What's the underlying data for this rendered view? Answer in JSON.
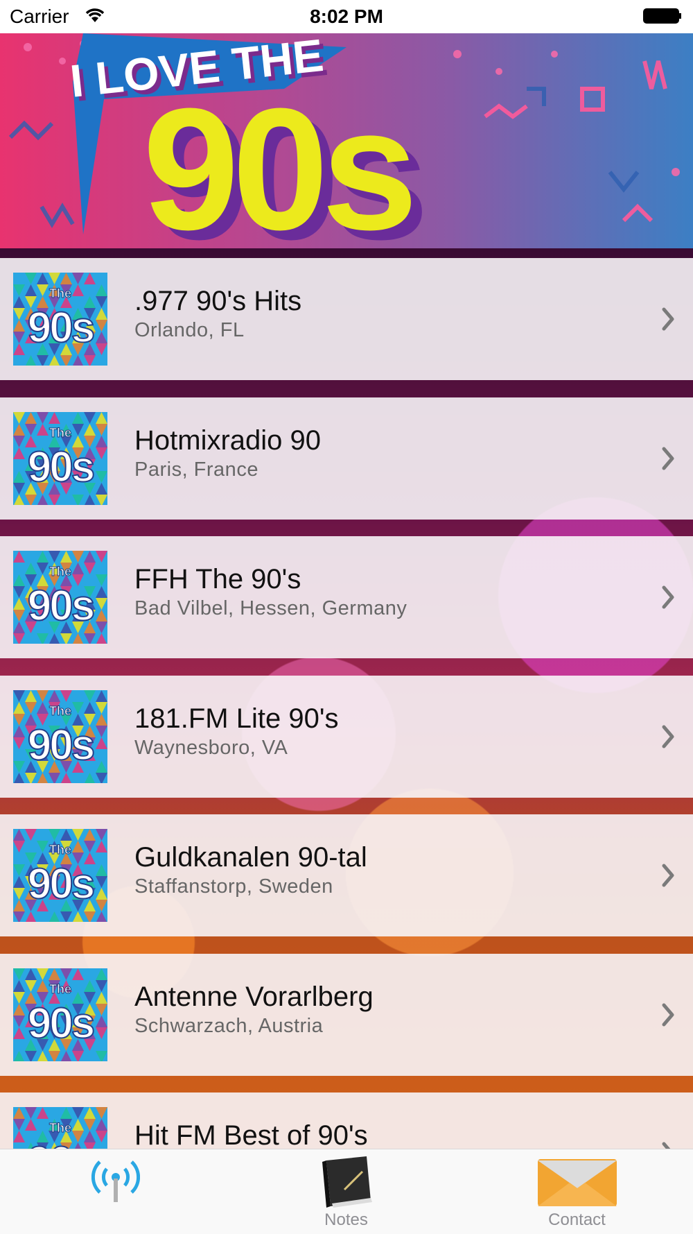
{
  "status_bar": {
    "carrier": "Carrier",
    "time": "8:02 PM"
  },
  "banner": {
    "line1": "I LOVE THE",
    "line2": "90s"
  },
  "thumbnail": {
    "small_text": "The",
    "big_text": "90s"
  },
  "stations": [
    {
      "name": ".977 90's Hits",
      "location": "Orlando, FL"
    },
    {
      "name": "Hotmixradio 90",
      "location": "Paris, France"
    },
    {
      "name": "FFH The 90's",
      "location": "Bad Vilbel, Hessen, Germany"
    },
    {
      "name": "181.FM Lite 90's",
      "location": "Waynesboro, VA"
    },
    {
      "name": "Guldkanalen 90-tal",
      "location": "Staffanstorp, Sweden"
    },
    {
      "name": "Antenne Vorarlberg",
      "location": "Schwarzach, Austria"
    },
    {
      "name": "Hit FM Best of 90's",
      "location": ""
    }
  ],
  "tab_bar": {
    "tabs": [
      {
        "label": "",
        "icon": "radio-broadcast-icon",
        "selected": true
      },
      {
        "label": "Notes",
        "icon": "notebook-icon",
        "selected": false
      },
      {
        "label": "Contact",
        "icon": "envelope-icon",
        "selected": false
      }
    ]
  },
  "colors": {
    "accent": "#2aa7e3",
    "banner_yellow": "#ecea1c",
    "banner_blue": "#1f73c6"
  }
}
